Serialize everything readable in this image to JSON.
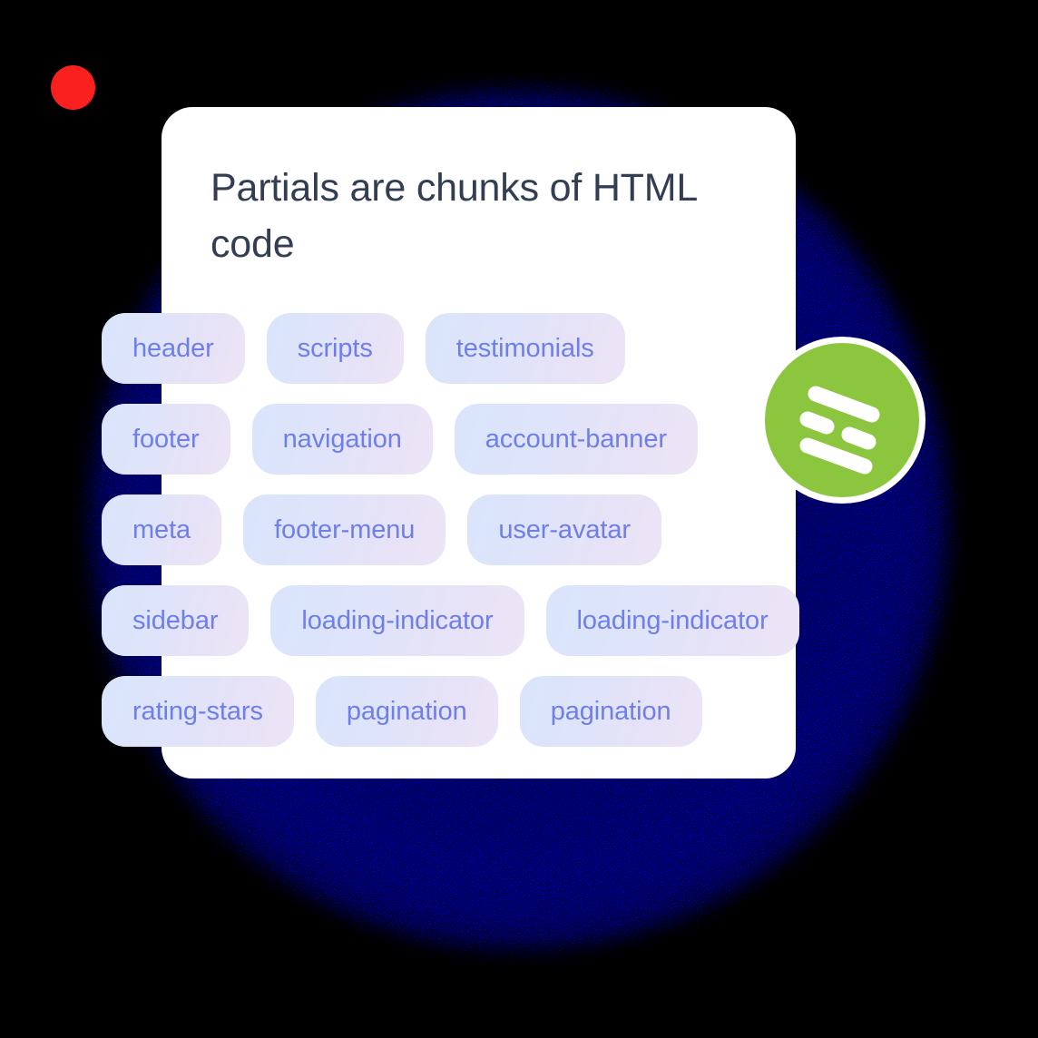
{
  "card": {
    "title": "Partials are chunks of HTML code"
  },
  "tag_rows": [
    [
      {
        "label": "header"
      },
      {
        "label": "scripts"
      },
      {
        "label": "testimonials"
      }
    ],
    [
      {
        "label": "footer"
      },
      {
        "label": "navigation"
      },
      {
        "label": "account-banner"
      }
    ],
    [
      {
        "label": "meta"
      },
      {
        "label": "footer-menu"
      },
      {
        "label": "user-avatar"
      }
    ],
    [
      {
        "label": "sidebar"
      },
      {
        "label": "loading-indicator"
      },
      {
        "label": "loading-indicator"
      }
    ],
    [
      {
        "label": "rating-stars"
      },
      {
        "label": "pagination"
      },
      {
        "label": "pagination"
      }
    ]
  ],
  "logo": {
    "name": "green-circle-logo",
    "icon": "slanted-bars-logo-icon"
  },
  "decorations": {
    "red_dot": "red-dot-marker"
  },
  "colors": {
    "background": "#000000",
    "glow_outer": "#6c5af6",
    "glow_inner": "#2a58d8",
    "card_background": "#ffffff",
    "title_text": "#333e52",
    "tag_text": "#6e7fe8",
    "tag_gradient_start": "#d9e5fb",
    "tag_gradient_end": "#ece5f6",
    "logo_green": "#8cc63f",
    "red_dot": "#fa2020"
  }
}
